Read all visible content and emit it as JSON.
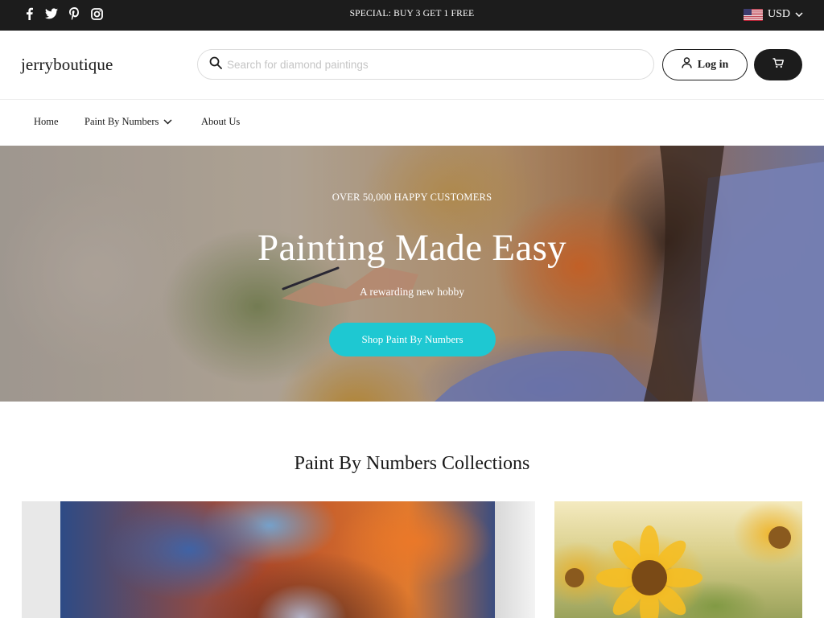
{
  "topbar": {
    "social_icons": [
      "facebook-icon",
      "twitter-icon",
      "pinterest-icon",
      "instagram-icon"
    ],
    "promo_text": "SPECIAL: BUY 3 GET 1 FREE",
    "currency": "USD",
    "flag_icon": "us-flag-icon",
    "background_color": "#1c1c1c"
  },
  "header": {
    "logo": "jerryboutique",
    "search": {
      "placeholder": "Search for diamond paintings",
      "value": ""
    },
    "login_label": "Log in",
    "cart_icon": "cart-icon"
  },
  "nav": {
    "items": [
      {
        "label": "Home"
      },
      {
        "label": "Paint By Numbers",
        "has_dropdown": true
      },
      {
        "label": "About Us"
      }
    ]
  },
  "hero": {
    "eyebrow": "OVER 50,000 HAPPY CUSTOMERS",
    "title": "Painting Made Easy",
    "subtitle": "A rewarding new hobby",
    "cta_label": "Shop Paint By Numbers",
    "cta_color": "#1ec8d2"
  },
  "collections": {
    "title": "Paint By Numbers Collections"
  }
}
